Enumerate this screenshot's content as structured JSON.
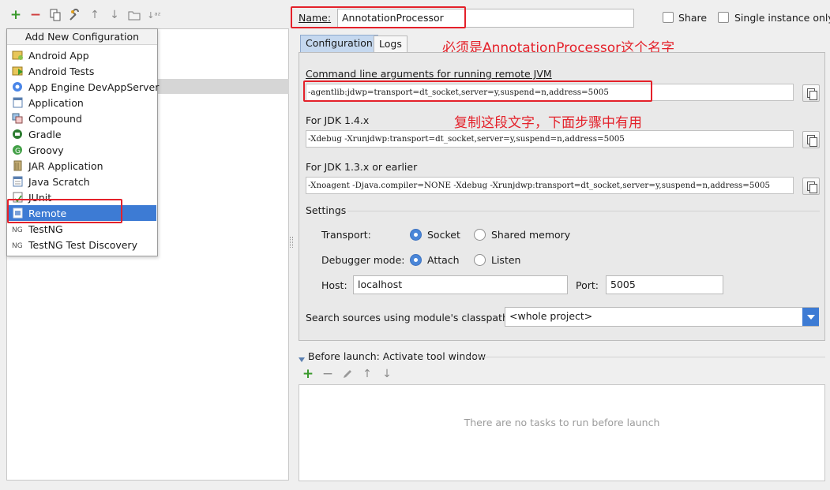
{
  "left_toolbar": {
    "add_icon": "plus-icon",
    "remove_icon": "minus-icon",
    "copy_icon": "copy-icon",
    "edit_defaults_icon": "wrench-icon",
    "move_up_icon": "arrow-up-icon",
    "move_down_icon": "arrow-down-icon",
    "folder_icon": "folder-icon",
    "sort_icon": "sort-az-icon"
  },
  "popup": {
    "title": "Add New Configuration",
    "items": [
      {
        "label": "Android App",
        "icon": "android-app-icon"
      },
      {
        "label": "Android Tests",
        "icon": "android-tests-icon"
      },
      {
        "label": "App Engine DevAppServer",
        "icon": "app-engine-icon"
      },
      {
        "label": "Application",
        "icon": "application-icon"
      },
      {
        "label": "Compound",
        "icon": "compound-icon"
      },
      {
        "label": "Gradle",
        "icon": "gradle-icon"
      },
      {
        "label": "Groovy",
        "icon": "groovy-icon"
      },
      {
        "label": "JAR Application",
        "icon": "jar-icon"
      },
      {
        "label": "Java Scratch",
        "icon": "java-scratch-icon"
      },
      {
        "label": "JUnit",
        "icon": "junit-icon"
      },
      {
        "label": "Remote",
        "icon": "remote-icon"
      },
      {
        "label": "TestNG",
        "icon": "testng-icon"
      },
      {
        "label": "TestNG Test Discovery",
        "icon": "testng-discovery-icon"
      }
    ],
    "selected": "Remote"
  },
  "header": {
    "name_label": "Name:",
    "name_value": "AnnotationProcessor",
    "share_label": "Share",
    "single_instance_label": "Single instance only"
  },
  "tabs": [
    {
      "label": "Configuration"
    },
    {
      "label": "Logs"
    }
  ],
  "annotations": {
    "name_note": "必须是AnnotationProcessor这个名字",
    "copy_note": "复制这段文字，下面步骤中有用"
  },
  "config": {
    "cmd_label": "Command line arguments for running remote JVM",
    "cmd_value": "-agentlib:jdwp=transport=dt_socket,server=y,suspend=n,address=5005",
    "jdk14_label": "For JDK 1.4.x",
    "jdk14_value": "-Xdebug -Xrunjdwp:transport=dt_socket,server=y,suspend=n,address=5005",
    "jdk13_label": "For JDK 1.3.x or earlier",
    "jdk13_value": "-Xnoagent -Djava.compiler=NONE -Xdebug -Xrunjdwp:transport=dt_socket,server=y,suspend=n,address=5005",
    "settings_label": "Settings",
    "transport_label": "Transport:",
    "transport_socket": "Socket",
    "transport_shared": "Shared memory",
    "debugger_label": "Debugger mode:",
    "debugger_attach": "Attach",
    "debugger_listen": "Listen",
    "host_label": "Host:",
    "host_value": "localhost",
    "port_label": "Port:",
    "port_value": "5005",
    "search_label": "Search sources using module's classpath:",
    "search_value": "<whole project>"
  },
  "before_launch": {
    "title": "Before launch: Activate tool window",
    "empty_text": "There are no tasks to run before launch"
  },
  "colors": {
    "selection": "#3d7bd4",
    "annotation_red": "#e4212a",
    "add_green": "#3a9a2c",
    "remove_red": "#d04040"
  }
}
